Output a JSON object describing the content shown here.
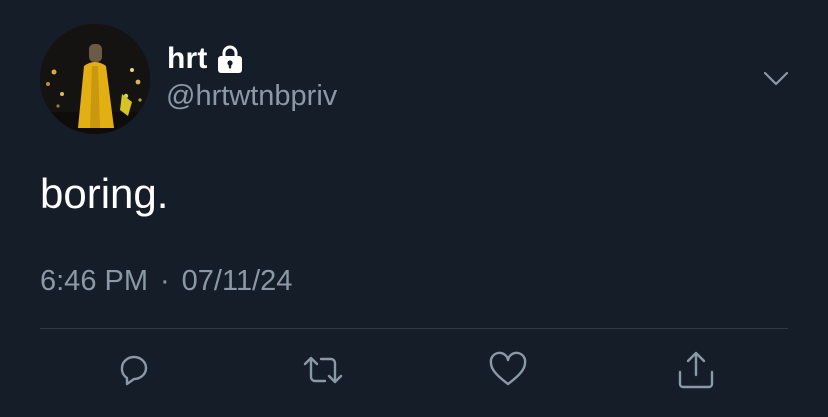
{
  "user": {
    "display_name": "hrt",
    "handle": "@hrtwtnbpriv",
    "avatar_icon": "profile-photo",
    "protected_icon": "lock-icon"
  },
  "tweet": {
    "text": "boring.",
    "time": "6:46 PM",
    "separator": "·",
    "date": "07/11/24"
  },
  "menu": {
    "icon": "chevron-down-icon"
  },
  "actions": [
    {
      "name": "reply",
      "icon": "reply-icon"
    },
    {
      "name": "retweet",
      "icon": "retweet-icon"
    },
    {
      "name": "like",
      "icon": "heart-icon"
    },
    {
      "name": "share",
      "icon": "share-icon"
    }
  ],
  "colors": {
    "background": "#151d28",
    "primary_text": "#ffffff",
    "secondary_text": "#8b98a5",
    "divider": "#2f3a46"
  }
}
